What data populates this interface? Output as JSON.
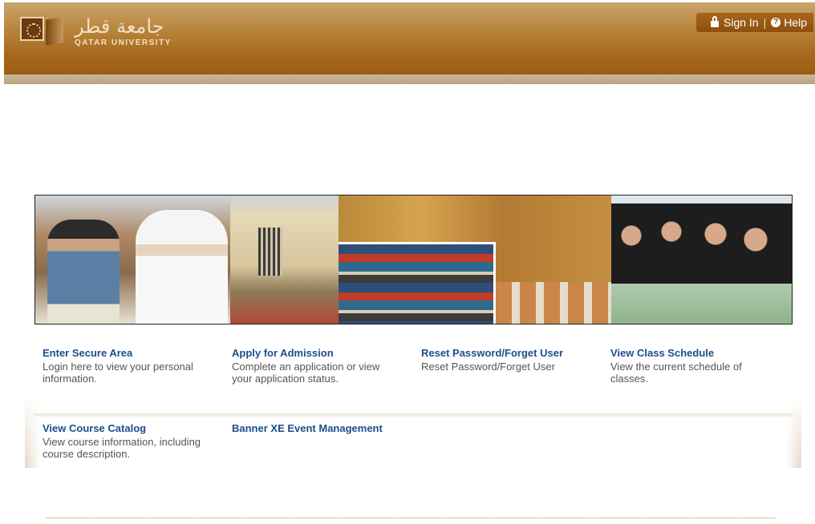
{
  "header": {
    "logo_arabic": "جامعة قطر",
    "logo_english": "QATAR UNIVERSITY",
    "sign_in_label": "Sign In",
    "separator": "|",
    "help_label": "Help"
  },
  "icons": {
    "sign_in": "lock-icon",
    "help": "help-icon",
    "help_glyph": "?"
  },
  "colors": {
    "header_brown": "#a96a1f",
    "link_blue": "#1c4e89"
  },
  "links": [
    {
      "title": "Enter Secure Area",
      "description": "Login here to view your personal information."
    },
    {
      "title": "Apply for Admission",
      "description": "Complete an application or view your application status."
    },
    {
      "title": "Reset Password/Forget User",
      "description": "Reset Password/Forget User"
    },
    {
      "title": "View Class Schedule",
      "description": "View the current schedule of classes."
    },
    {
      "title": "View Course Catalog",
      "description": "View course information, including course description."
    },
    {
      "title": "Banner XE Event Management",
      "description": ""
    }
  ]
}
